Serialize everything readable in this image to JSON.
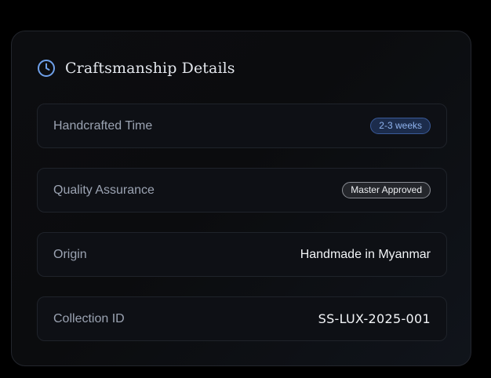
{
  "card": {
    "title": "Craftsmanship Details",
    "icon": "clock-icon",
    "accent_color": "#6fa0ea"
  },
  "rows": [
    {
      "label": "Handcrafted Time",
      "value": "2-3 weeks",
      "type": "badge",
      "badge_style": "blue"
    },
    {
      "label": "Quality Assurance",
      "value": "Master Approved",
      "type": "badge",
      "badge_style": "gray"
    },
    {
      "label": "Origin",
      "value": "Handmade in Myanmar",
      "type": "text"
    },
    {
      "label": "Collection ID",
      "value": "SS-LUX-2025-001",
      "type": "mono"
    }
  ]
}
